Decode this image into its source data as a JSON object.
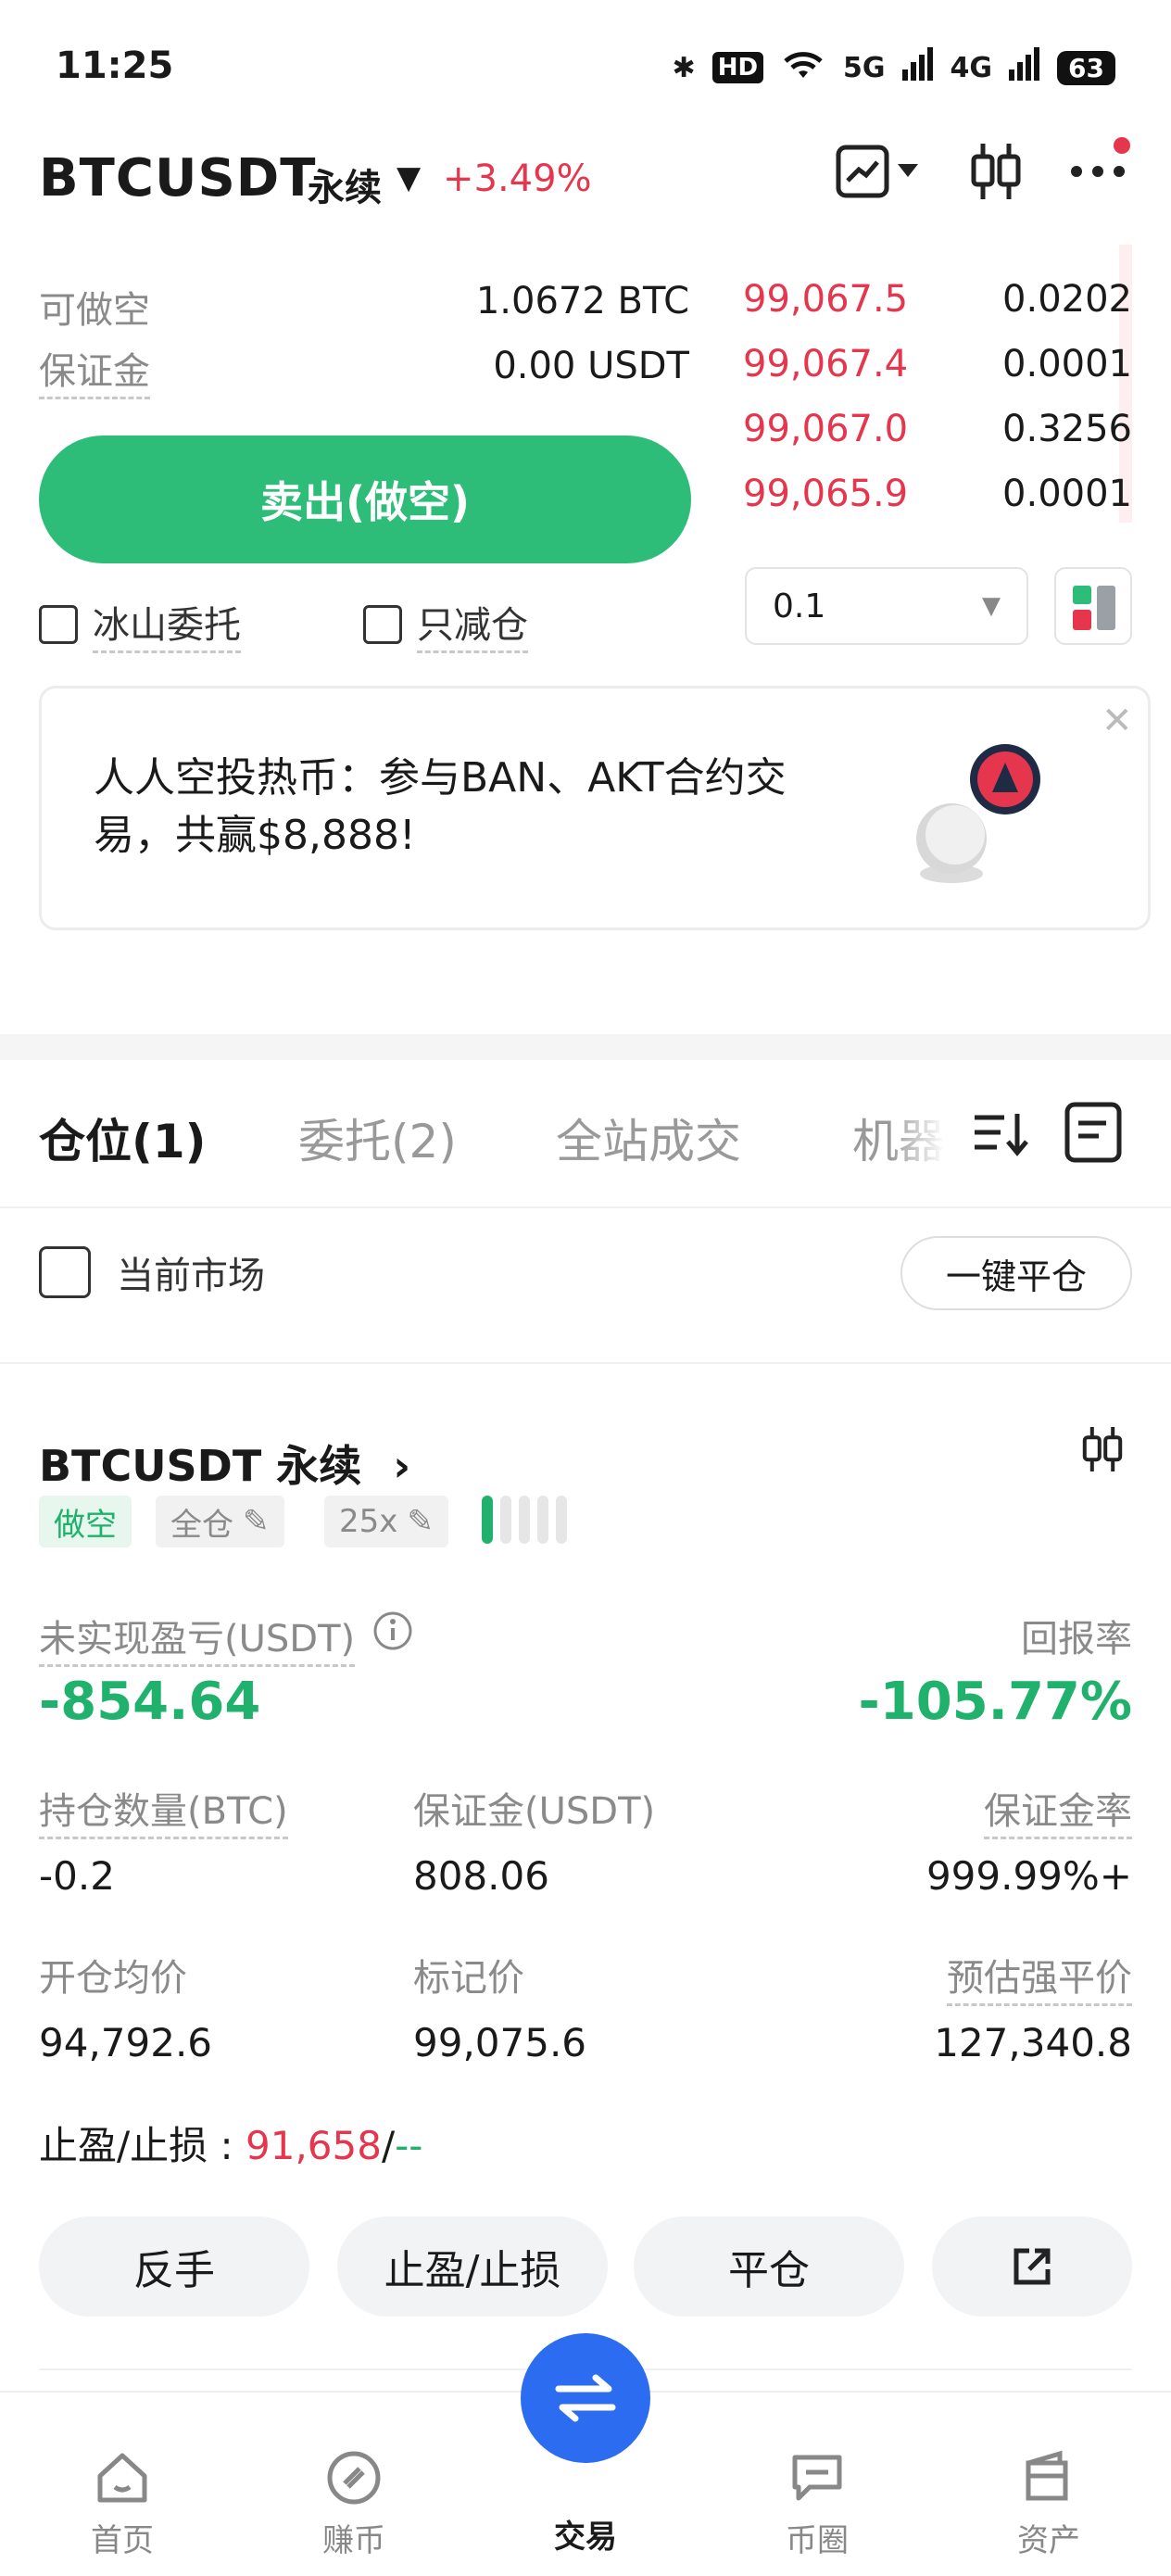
{
  "status_bar": {
    "time": "11:25",
    "hd": "HD",
    "net1": "5G",
    "net2": "4G",
    "battery": "63"
  },
  "header": {
    "symbol": "BTCUSDT",
    "contract_type": "永续",
    "change_pct": "+3.49%"
  },
  "order_form": {
    "short_label": "可做空",
    "short_value": "1.0672 BTC",
    "margin_label": "保证金",
    "margin_value": "0.00 USDT",
    "sell_button": "卖出(做空)",
    "iceberg_label": "冰山委托",
    "reduce_only_label": "只减仓"
  },
  "order_book": {
    "rows": [
      {
        "price": "99,067.5",
        "qty": "0.0202"
      },
      {
        "price": "99,067.4",
        "qty": "0.0001"
      },
      {
        "price": "99,067.0",
        "qty": "0.3256"
      },
      {
        "price": "99,065.9",
        "qty": "0.0001"
      }
    ],
    "precision": "0.1"
  },
  "promo": {
    "text": "人人空投热币：参与BAN、AKT合约交易，共赢$8,888!"
  },
  "tabs": [
    {
      "label": "仓位(1)"
    },
    {
      "label": "委托(2)"
    },
    {
      "label": "全站成交"
    },
    {
      "label": "机器"
    }
  ],
  "filter": {
    "current_market": "当前市场",
    "close_all": "一键平仓"
  },
  "position": {
    "symbol": "BTCUSDT 永续",
    "side_tag": "做空",
    "margin_mode": "全仓",
    "leverage": "25x",
    "leverage_level": 0.2,
    "unrealized_label": "未实现盈亏(USDT)",
    "unrealized_value": "-854.64",
    "roe_label": "回报率",
    "roe_value": "-105.77%",
    "size_label": "持仓数量(BTC)",
    "size_value": "-0.2",
    "margin_label": "保证金(USDT)",
    "margin_value": "808.06",
    "margin_ratio_label": "保证金率",
    "margin_ratio_value": "999.99%+",
    "entry_label": "开仓均价",
    "entry_value": "94,792.6",
    "mark_label": "标记价",
    "mark_value": "99,075.6",
    "liq_label": "预估强平价",
    "liq_value": "127,340.8",
    "tpsl_label": "止盈/止损 : ",
    "tp_value": "91,658",
    "tpsl_sep": "/",
    "sl_value": "--",
    "actions": {
      "reverse": "反手",
      "tpsl": "止盈/止损",
      "close": "平仓"
    }
  },
  "bottom_nav": {
    "home": "首页",
    "earn": "赚币",
    "trade": "交易",
    "community": "币圈",
    "assets": "资产"
  },
  "colors": {
    "up_red": "#e5364e",
    "down_green": "#20b26c",
    "sell_button": "#2ebd78",
    "trade_fab": "#2b6cf0"
  }
}
